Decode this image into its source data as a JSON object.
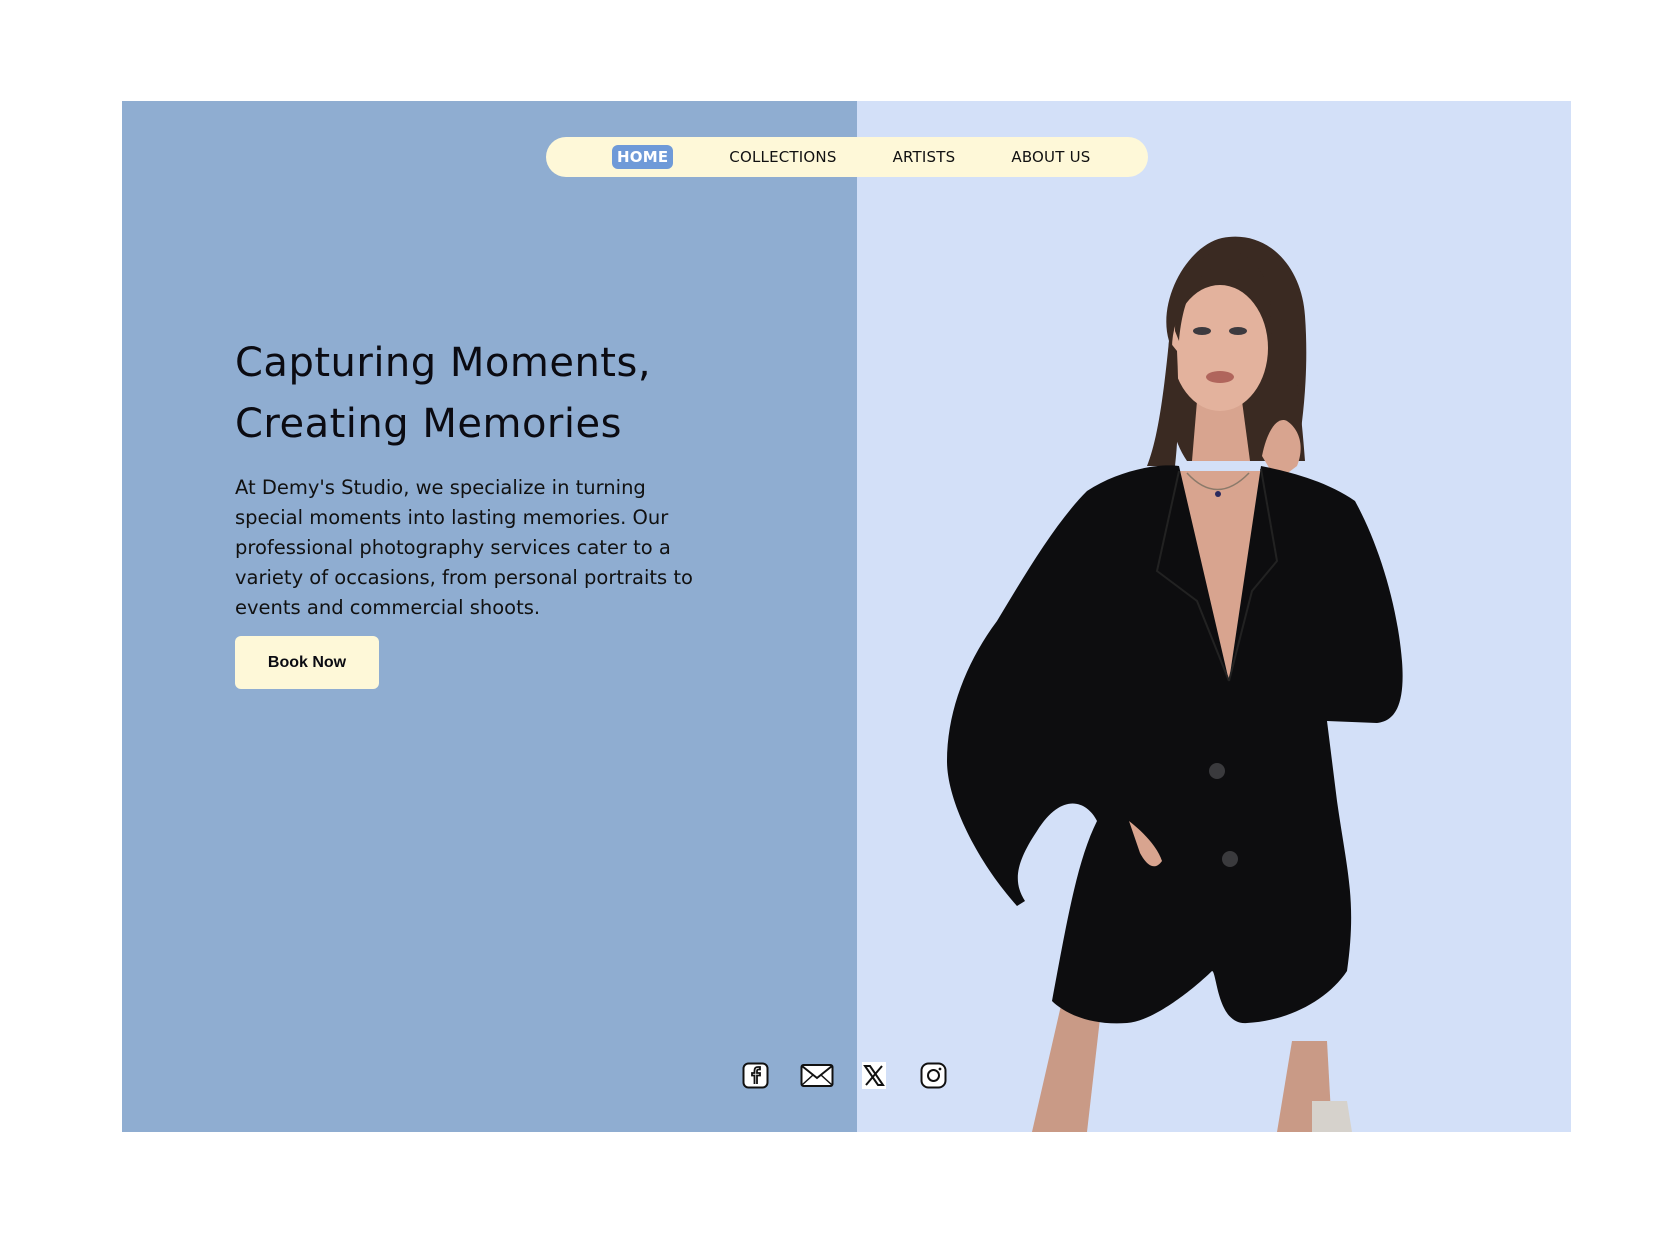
{
  "nav": {
    "items": [
      {
        "label": "HOME",
        "active": true
      },
      {
        "label": "COLLECTIONS",
        "active": false
      },
      {
        "label": "ARTISTS",
        "active": false
      },
      {
        "label": "ABOUT US",
        "active": false
      }
    ]
  },
  "hero": {
    "title_line1": "Capturing Moments,",
    "title_line2": "Creating Memories",
    "description": "At Demy's Studio, we specialize in turning special moments into lasting memories. Our professional photography services cater to a variety of occasions, from personal portraits to events and commercial shoots.",
    "cta_label": "Book Now"
  },
  "social": {
    "icons": [
      "facebook-icon",
      "mail-icon",
      "x-icon",
      "instagram-icon"
    ]
  },
  "colors": {
    "left_panel": "#8fadd1",
    "right_panel": "#d3e0f8",
    "cream": "#fef8d8",
    "accent": "#6f9ad8"
  }
}
